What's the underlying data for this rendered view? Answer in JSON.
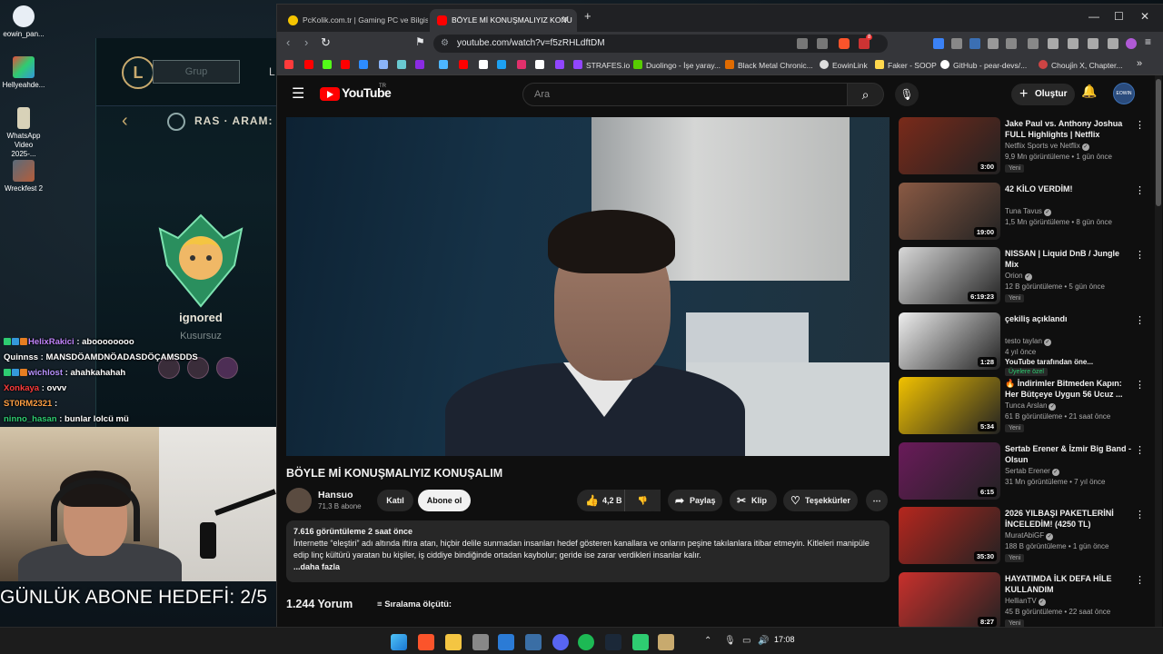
{
  "desktop": {
    "icons": [
      {
        "label": "eowin_pan..."
      },
      {
        "label": "Hellyeahde..."
      },
      {
        "label": "WhatsApp Video 2025-..."
      },
      {
        "label": "Wreckfest 2"
      }
    ]
  },
  "league": {
    "group_label": "Grup",
    "side_letter": "L",
    "mode_title": "RAS · ARAM: Ş",
    "player_name": "ignored",
    "player_sub": "Kusursuz"
  },
  "chat": [
    {
      "user": "HelixRakici",
      "color": "#c084fc",
      "msg": " : aboooooooo",
      "badges": [
        "#2ecc71",
        "#3498db",
        "#e67e22"
      ]
    },
    {
      "user": "Quinnss",
      "color": "#ffffff",
      "msg": " : MANSDÖAMDNÖADASDÖÇAMSDDS",
      "badges": []
    },
    {
      "user": "wichlost",
      "color": "#b892ff",
      "msg": " : ahahkahahah",
      "badges": [
        "#2ecc71",
        "#3498db",
        "#e67e22"
      ]
    },
    {
      "user": "Xonkaya",
      "color": "#ff3b3b",
      "msg": " : ovvv",
      "badges": []
    },
    {
      "user": "ST0RM2321",
      "color": "#ff9f43",
      "msg": " : ",
      "badges": []
    },
    {
      "user": "ninno_hasan",
      "color": "#2ecc71",
      "msg": " : bunlar lolcü mü",
      "badges": []
    }
  ],
  "overlay": {
    "goal_text": "GÜNLÜK ABONE HEDEFİ: 2/5"
  },
  "browser": {
    "tabs": [
      {
        "title": "PcKolik.com.tr | Gaming PC ve Bilgisa",
        "active": false
      },
      {
        "title": "BÖYLE Mİ KONUŞMALIYIZ KONU",
        "active": true
      }
    ],
    "url": "youtube.com/watch?v=f5zRHLdftDM",
    "ext_badge": "8",
    "bookmarks": [
      "STRAFES.io",
      "Duolingo - İşe yaray...",
      "Black Metal Chronic...",
      "EowinLink",
      "Faker - SOOP",
      "GitHub - pear-devs/...",
      "Chouji̇n X, Chapter..."
    ]
  },
  "youtube": {
    "brand": "YouTube",
    "region": "TR",
    "search_placeholder": "Ara",
    "create_label": "Oluştur",
    "avatar_text": "EOWIN",
    "video": {
      "title": "BÖYLE Mİ KONUŞMALIYIZ KONUŞALIM",
      "channel": "Hansuo",
      "subs": "71,3 B abone",
      "join": "Katıl",
      "subscribe": "Abone ol",
      "likes": "4,2 B",
      "share": "Paylaş",
      "clip": "Klip",
      "thanks": "Teşekkürler",
      "views_line": "7.616 görüntüleme  2 saat önce",
      "description": "İnternette “eleştiri” adı altında iftira atan, hiçbir delile sunmadan insanları hedef gösteren kanallara ve onların peşine takılanlara itibar etmeyin. Kitleleri manipüle edip linç kültürü yaratan bu kişiler, iş ciddiye bindiğinde ortadan kaybolur; geride ise zarar verdikleri insanlar kalır.",
      "more": "...daha fazla",
      "comments": "1.244 Yorum",
      "sort": "Sıralama ölçütü:"
    },
    "recommendations": [
      {
        "title": "Jake Paul vs. Anthony Joshua FULL Highlights | Netflix",
        "channel": "Netflix Sports ve Netflix",
        "meta": "9,9 Mn görüntüleme • 1 gün önce",
        "badge": "Yeni",
        "duration": "3:00",
        "thumb": "#7a2a1a"
      },
      {
        "title": "42 KİLO VERDİM!",
        "channel": "Tuna Tavus",
        "meta": "1,5 Mn görüntüleme • 8 gün önce",
        "badge": "",
        "duration": "19:00",
        "thumb": "#8a5a44"
      },
      {
        "title": "NISSAN | Liquid DnB / Jungle Mix",
        "channel": "Orion",
        "meta": "12 B görüntüleme • 5 gün önce",
        "badge": "Yeni",
        "duration": "6:19:23",
        "thumb": "#d8d8d8"
      },
      {
        "title": "çekiliş açıklandı",
        "channel": "testo taylan",
        "meta": "4 yıl önce",
        "extra": "YouTube tarafından öne...",
        "badge": "Üyelere özel",
        "duration": "1:28",
        "thumb": "#eeeeee"
      },
      {
        "title": "🔥 İndirimler Bitmeden Kapın: Her Bütçeye Uygun 56 Ucuz ...",
        "channel": "Tunca Arslan",
        "meta": "61 B görüntüleme • 21 saat önce",
        "badge": "Yeni",
        "duration": "5:34",
        "thumb": "#f2c200"
      },
      {
        "title": "Sertab Erener & İzmir Big Band - Olsun",
        "channel": "Sertab Erener",
        "meta": "31 Mn görüntüleme • 7 yıl önce",
        "badge": "",
        "duration": "6:15",
        "thumb": "#6a1a5a"
      },
      {
        "title": "2026 YILBAŞI PAKETLERİNİ İNCELEDİM! (4250 TL)",
        "channel": "MuratAbiGF",
        "meta": "188 B görüntüleme • 1 gün önce",
        "badge": "Yeni",
        "duration": "35:30",
        "thumb": "#b6261e"
      },
      {
        "title": "HAYATIMDA İLK DEFA HİLE KULLANDIM",
        "channel": "HellianTV",
        "meta": "45 B görüntüleme • 22 saat önce",
        "badge": "Yeni",
        "duration": "8:27",
        "thumb": "#c9302c"
      }
    ]
  },
  "taskbar": {
    "time": "17:08"
  }
}
